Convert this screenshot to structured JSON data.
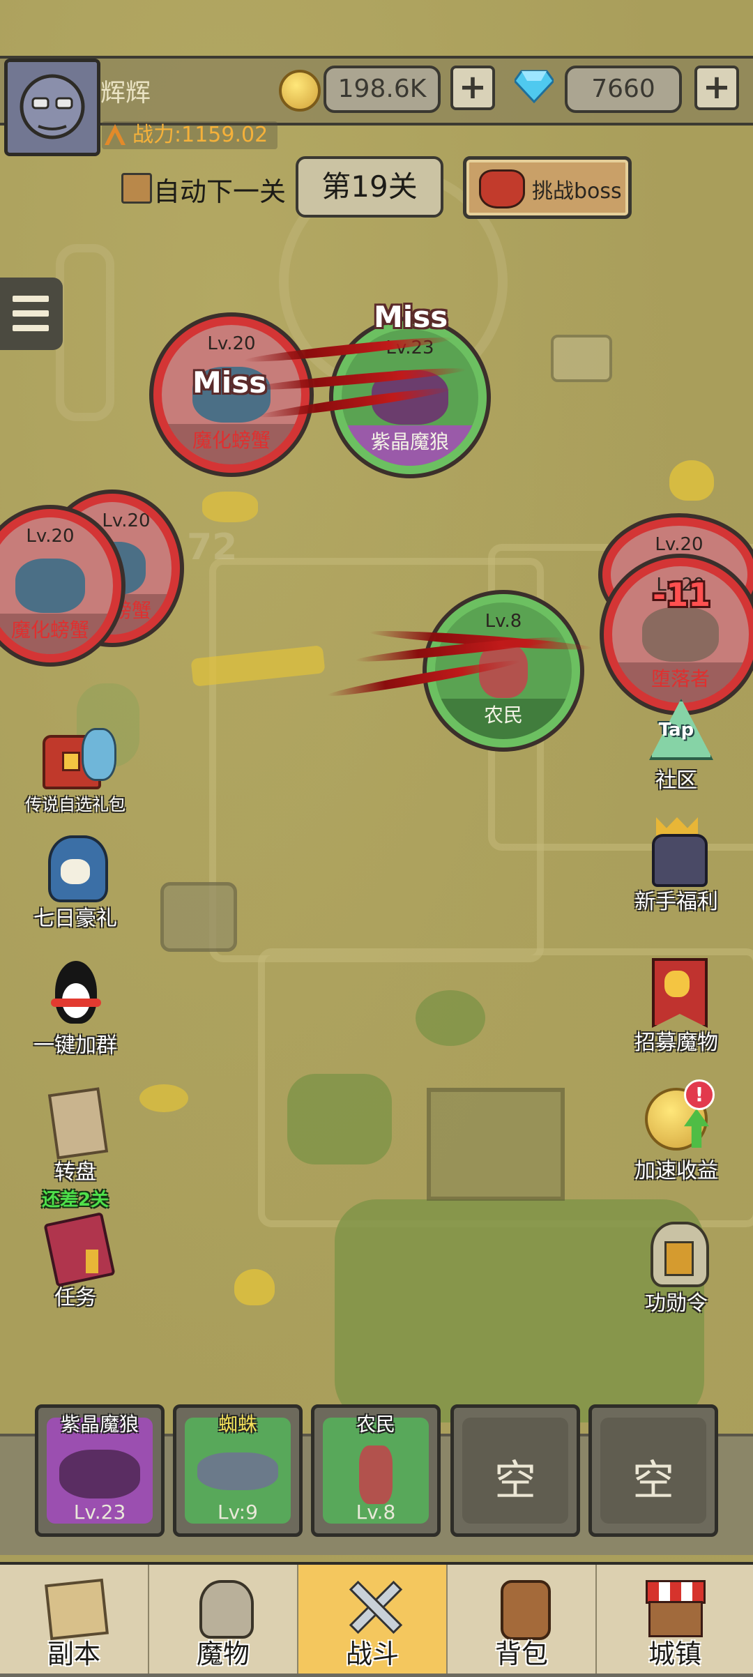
{
  "player": {
    "name": "辉辉",
    "power": "战力:1159.02"
  },
  "currency": {
    "gold": "198.6K",
    "gems": "7660"
  },
  "battle": {
    "auto_next_label": "自动下一关",
    "stage_label": "第19关",
    "boss_button_label": "挑战boss"
  },
  "units": [
    {
      "level": "Lv.20",
      "name": "魔化螃蟹",
      "side": "enemy"
    },
    {
      "level": "Lv.23",
      "name": "紫晶魔狼",
      "side": "ally"
    },
    {
      "level": "Lv.20",
      "name": "魔化螃蟹",
      "side": "enemy"
    },
    {
      "level": "Lv.20",
      "name": "魔化螃蟹",
      "side": "enemy"
    },
    {
      "level": "Lv.8",
      "name": "农民",
      "side": "ally"
    },
    {
      "level": "Lv.20",
      "name": "",
      "side": "enemy"
    },
    {
      "level": "Lv.20",
      "name": "堕落者",
      "side": "enemy"
    }
  ],
  "floating_text": {
    "miss_a": "Miss",
    "miss_b": "Miss",
    "damage": "-11",
    "faded_num": "72"
  },
  "left_menu": [
    {
      "label": "传说自选礼包",
      "icon": "treasure-chest-icon"
    },
    {
      "label": "七日豪礼",
      "icon": "knight-helmet-icon"
    },
    {
      "label": "一键加群",
      "icon": "penguin-icon"
    },
    {
      "label": "转盘",
      "sub": "还差2关",
      "icon": "scroll-icon"
    },
    {
      "label": "任务",
      "icon": "book-icon"
    }
  ],
  "right_menu": [
    {
      "label": "社区",
      "tap": "Tap",
      "icon": "tap-crystal-icon"
    },
    {
      "label": "新手福利",
      "icon": "king-icon"
    },
    {
      "label": "招募魔物",
      "icon": "banner-icon"
    },
    {
      "label": "加速收益",
      "badge": "!",
      "icon": "gold-coin-arrow-icon"
    },
    {
      "label": "功勋令",
      "icon": "helmet-icon"
    }
  ],
  "deploy_slots": [
    {
      "name": "紫晶魔狼",
      "level": "Lv.23",
      "color": "#9b4fb0"
    },
    {
      "name": "蜘蛛",
      "level": "Lv:9",
      "color": "#58a85a"
    },
    {
      "name": "农民",
      "level": "Lv.8",
      "color": "#58a85a"
    },
    {
      "empty": "空"
    },
    {
      "empty": "空"
    }
  ],
  "nav": [
    {
      "label": "副本",
      "icon": "map-icon"
    },
    {
      "label": "魔物",
      "icon": "monster-helmet-icon"
    },
    {
      "label": "战斗",
      "icon": "crossed-swords-icon",
      "active": true
    },
    {
      "label": "背包",
      "icon": "backpack-icon"
    },
    {
      "label": "城镇",
      "icon": "shop-icon"
    }
  ],
  "colors": {
    "enemy_ring": "#d43535",
    "ally_ring": "#6cc061",
    "active_tab": "#f4c75e",
    "power_text": "#f5b13a"
  }
}
